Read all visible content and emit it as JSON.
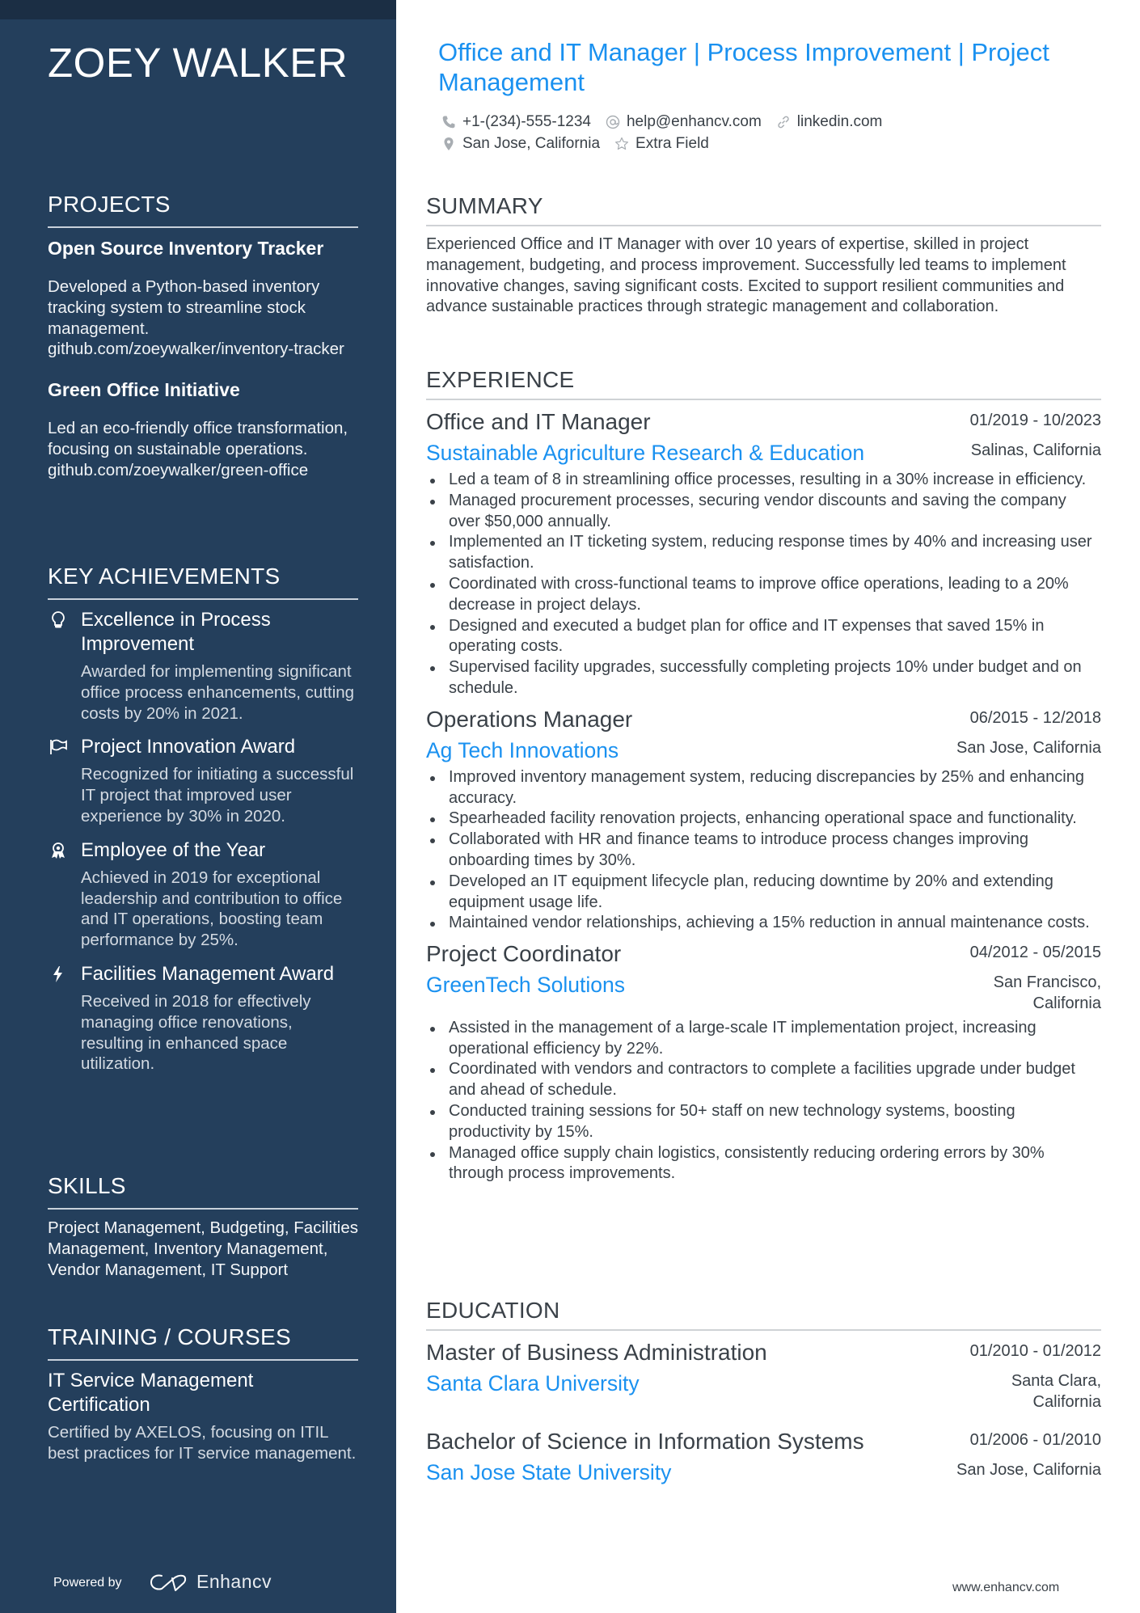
{
  "name": "ZOEY WALKER",
  "headline": "Office and IT Manager | Process Improvement | Project Management",
  "contacts": {
    "phone": "+1-(234)-555-1234",
    "email": "help@enhancv.com",
    "linkedin": "linkedin.com",
    "location": "San Jose, California",
    "extra": "Extra Field"
  },
  "colors": {
    "sidebar_bg": "#243f5c",
    "accent": "#1a91f0",
    "text": "#3a4148"
  },
  "sidebar": {
    "projects": {
      "heading": "PROJECTS",
      "items": [
        {
          "title": "Open Source Inventory Tracker",
          "description": "Developed a Python-based inventory tracking system to streamline stock management. github.com/zoeywalker/inventory-tracker"
        },
        {
          "title": "Green Office Initiative",
          "description": "Led an eco-friendly office transformation, focusing on sustainable operations. github.com/zoeywalker/green-office"
        }
      ]
    },
    "achievements": {
      "heading": "KEY ACHIEVEMENTS",
      "items": [
        {
          "icon": "lightbulb-icon",
          "title": "Excellence in Process Improvement",
          "description": "Awarded for implementing significant office process enhancements, cutting costs by 20% in 2021."
        },
        {
          "icon": "flag-icon",
          "title": "Project Innovation Award",
          "description": "Recognized for initiating a successful IT project that improved user experience by 30% in 2020."
        },
        {
          "icon": "medal-icon",
          "title": "Employee of the Year",
          "description": "Achieved in 2019 for exceptional leadership and contribution to office and IT operations, boosting team performance by 25%."
        },
        {
          "icon": "lightning-icon",
          "title": "Facilities Management Award",
          "description": "Received in 2018 for effectively managing office renovations, resulting in enhanced space utilization."
        }
      ]
    },
    "skills": {
      "heading": "SKILLS",
      "text": "Project Management, Budgeting, Facilities Management, Inventory Management, Vendor Management, IT Support"
    },
    "training": {
      "heading": "TRAINING / COURSES",
      "items": [
        {
          "title": "IT Service Management Certification",
          "description": "Certified by AXELOS, focusing on ITIL best practices for IT service management."
        }
      ]
    },
    "footer": {
      "powered_by": "Powered by",
      "brand": "Enhancv"
    }
  },
  "main": {
    "summary": {
      "heading": "SUMMARY",
      "text": "Experienced Office and IT Manager with over 10 years of expertise, skilled in project management, budgeting, and process improvement. Successfully led teams to implement innovative changes, saving significant costs. Excited to support resilient communities and advance sustainable practices through strategic management and collaboration."
    },
    "experience": {
      "heading": "EXPERIENCE",
      "jobs": [
        {
          "title": "Office and IT Manager",
          "dates": "01/2019 - 10/2023",
          "company": "Sustainable Agriculture Research & Education",
          "location": "Salinas, California",
          "bullets": [
            "Led a team of 8 in streamlining office processes, resulting in a 30% increase in efficiency.",
            "Managed procurement processes, securing vendor discounts and saving the company over $50,000 annually.",
            "Implemented an IT ticketing system, reducing response times by 40% and increasing user satisfaction.",
            "Coordinated with cross-functional teams to improve office operations, leading to a 20% decrease in project delays.",
            "Designed and executed a budget plan for office and IT expenses that saved 15% in operating costs.",
            "Supervised facility upgrades, successfully completing projects 10% under budget and on schedule."
          ]
        },
        {
          "title": "Operations Manager",
          "dates": "06/2015 - 12/2018",
          "company": "Ag Tech Innovations",
          "location": "San Jose, California",
          "bullets": [
            "Improved inventory management system, reducing discrepancies by 25% and enhancing accuracy.",
            "Spearheaded facility renovation projects, enhancing operational space and functionality.",
            "Collaborated with HR and finance teams to introduce process changes improving onboarding times by 30%.",
            "Developed an IT equipment lifecycle plan, reducing downtime by 20% and extending equipment usage life.",
            "Maintained vendor relationships, achieving a 15% reduction in annual maintenance costs."
          ]
        },
        {
          "title": "Project Coordinator",
          "dates": "04/2012 - 05/2015",
          "company": "GreenTech Solutions",
          "location": "San Francisco, California",
          "bullets": [
            "Assisted in the management of a large-scale IT implementation project, increasing operational efficiency by 22%.",
            "Coordinated with vendors and contractors to complete a facilities upgrade under budget and ahead of schedule.",
            "Conducted training sessions for 50+ staff on new technology systems, boosting productivity by 15%.",
            "Managed office supply chain logistics, consistently reducing ordering errors by 30% through process improvements."
          ]
        }
      ]
    },
    "education": {
      "heading": "EDUCATION",
      "items": [
        {
          "degree": "Master of Business Administration",
          "dates": "01/2010 - 01/2012",
          "school": "Santa Clara University",
          "location": "Santa Clara, California"
        },
        {
          "degree": "Bachelor of Science in Information Systems",
          "dates": "01/2006 - 01/2010",
          "school": "San Jose State University",
          "location": "San Jose, California"
        }
      ]
    },
    "footer_url": "www.enhancv.com"
  }
}
